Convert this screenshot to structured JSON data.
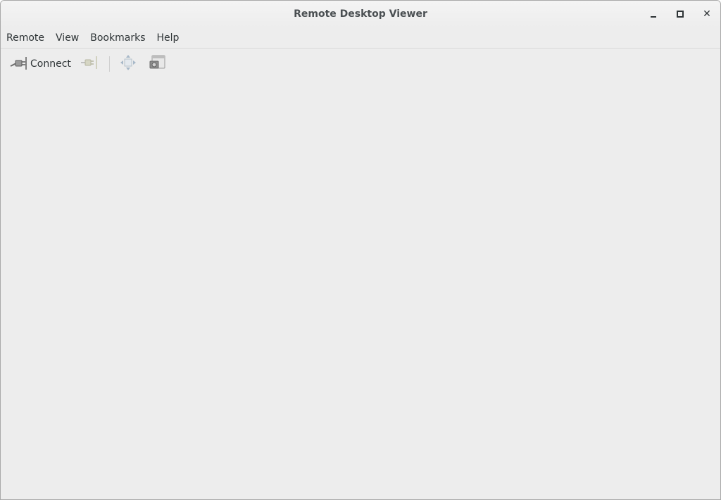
{
  "window": {
    "title": "Remote Desktop Viewer"
  },
  "menubar": {
    "items": [
      "Remote",
      "View",
      "Bookmarks",
      "Help"
    ]
  },
  "toolbar": {
    "connect_label": "Connect",
    "icons": {
      "connect": "plug-connect-icon",
      "disconnect": "plug-disconnect-icon",
      "fullscreen": "fullscreen-arrows-icon",
      "screenshot": "screenshot-icon"
    }
  },
  "colors": {
    "window_bg": "#ededed",
    "text": "#2e3436",
    "title_text": "#4a4f52"
  }
}
